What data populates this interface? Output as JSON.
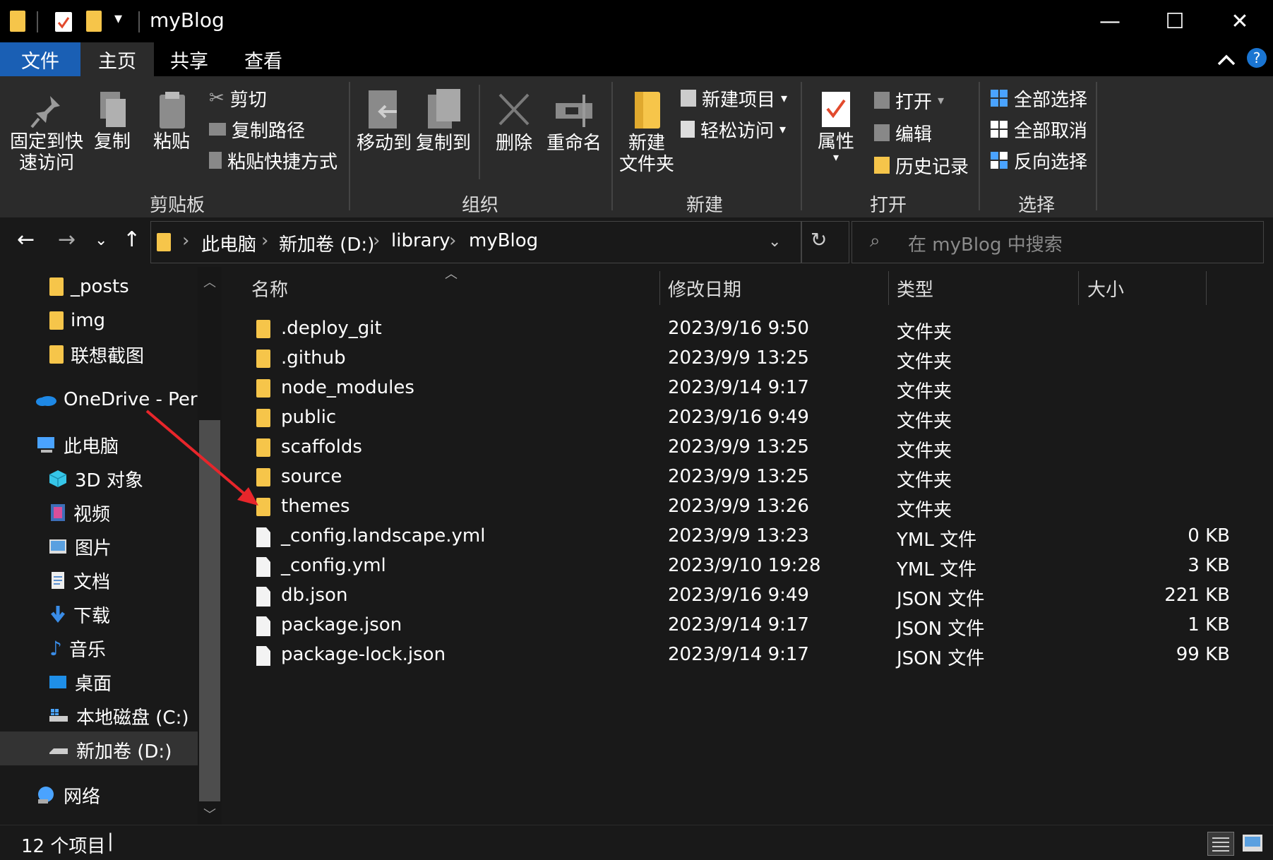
{
  "window": {
    "title": "myBlog",
    "buttons": {
      "minimize": "—",
      "maximize": "☐",
      "close": "✕"
    }
  },
  "tabs": [
    {
      "label": "文件",
      "active_file": true
    },
    {
      "label": "主页",
      "selected": true
    },
    {
      "label": "共享"
    },
    {
      "label": "查看"
    }
  ],
  "help_label": "?",
  "ribbon": {
    "clipboard": {
      "pin_l1": "固定到快",
      "pin_l2": "速访问",
      "copy": "复制",
      "paste": "粘贴",
      "cut": "剪切",
      "copy_path": "复制路径",
      "paste_shortcut": "粘贴快捷方式",
      "group": "剪贴板"
    },
    "organize": {
      "move_to": "移动到",
      "copy_to": "复制到",
      "delete": "删除",
      "rename": "重命名",
      "group": "组织"
    },
    "new": {
      "new_folder_l1": "新建",
      "new_folder_l2": "文件夹",
      "new_item": "新建项目",
      "easy_access": "轻松访问",
      "group": "新建"
    },
    "open": {
      "properties": "属性",
      "open": "打开",
      "edit": "编辑",
      "history": "历史记录",
      "group": "打开"
    },
    "select": {
      "select_all": "全部选择",
      "select_none": "全部取消",
      "invert": "反向选择",
      "group": "选择"
    }
  },
  "address": {
    "crumbs": [
      "此电脑",
      "新加卷 (D:)",
      "library",
      "myBlog"
    ],
    "search_placeholder": "在 myBlog 中搜索"
  },
  "nav": {
    "items": [
      {
        "label": "_posts"
      },
      {
        "label": "img"
      },
      {
        "label": "联想截图"
      },
      {
        "label": "OneDrive - Persc"
      },
      {
        "label": "此电脑"
      },
      {
        "label": "3D 对象"
      },
      {
        "label": "视频"
      },
      {
        "label": "图片"
      },
      {
        "label": "文档"
      },
      {
        "label": "下载"
      },
      {
        "label": "音乐"
      },
      {
        "label": "桌面"
      },
      {
        "label": "本地磁盘 (C:)"
      },
      {
        "label": "新加卷 (D:)",
        "selected": true
      },
      {
        "label": "网络"
      }
    ]
  },
  "columns": {
    "name": "名称",
    "date": "修改日期",
    "type": "类型",
    "size": "大小"
  },
  "files": [
    {
      "name": ".deploy_git",
      "date": "2023/9/16 9:50",
      "type": "文件夹",
      "size": "",
      "kind": "folder"
    },
    {
      "name": ".github",
      "date": "2023/9/9 13:25",
      "type": "文件夹",
      "size": "",
      "kind": "folder"
    },
    {
      "name": "node_modules",
      "date": "2023/9/14 9:17",
      "type": "文件夹",
      "size": "",
      "kind": "folder"
    },
    {
      "name": "public",
      "date": "2023/9/16 9:49",
      "type": "文件夹",
      "size": "",
      "kind": "folder"
    },
    {
      "name": "scaffolds",
      "date": "2023/9/9 13:25",
      "type": "文件夹",
      "size": "",
      "kind": "folder"
    },
    {
      "name": "source",
      "date": "2023/9/9 13:25",
      "type": "文件夹",
      "size": "",
      "kind": "folder"
    },
    {
      "name": "themes",
      "date": "2023/9/9 13:26",
      "type": "文件夹",
      "size": "",
      "kind": "folder"
    },
    {
      "name": "_config.landscape.yml",
      "date": "2023/9/9 13:23",
      "type": "YML 文件",
      "size": "0 KB",
      "kind": "file"
    },
    {
      "name": "_config.yml",
      "date": "2023/9/10 19:28",
      "type": "YML 文件",
      "size": "3 KB",
      "kind": "file"
    },
    {
      "name": "db.json",
      "date": "2023/9/16 9:49",
      "type": "JSON 文件",
      "size": "221 KB",
      "kind": "file"
    },
    {
      "name": "package.json",
      "date": "2023/9/14 9:17",
      "type": "JSON 文件",
      "size": "1 KB",
      "kind": "file"
    },
    {
      "name": "package-lock.json",
      "date": "2023/9/14 9:17",
      "type": "JSON 文件",
      "size": "99 KB",
      "kind": "file"
    }
  ],
  "status": {
    "count": "12 个项目",
    "divider": "|"
  },
  "colors": {
    "accent": "#1a5fb4",
    "folder": "#f6c54a",
    "annotation": "#e8262b"
  }
}
